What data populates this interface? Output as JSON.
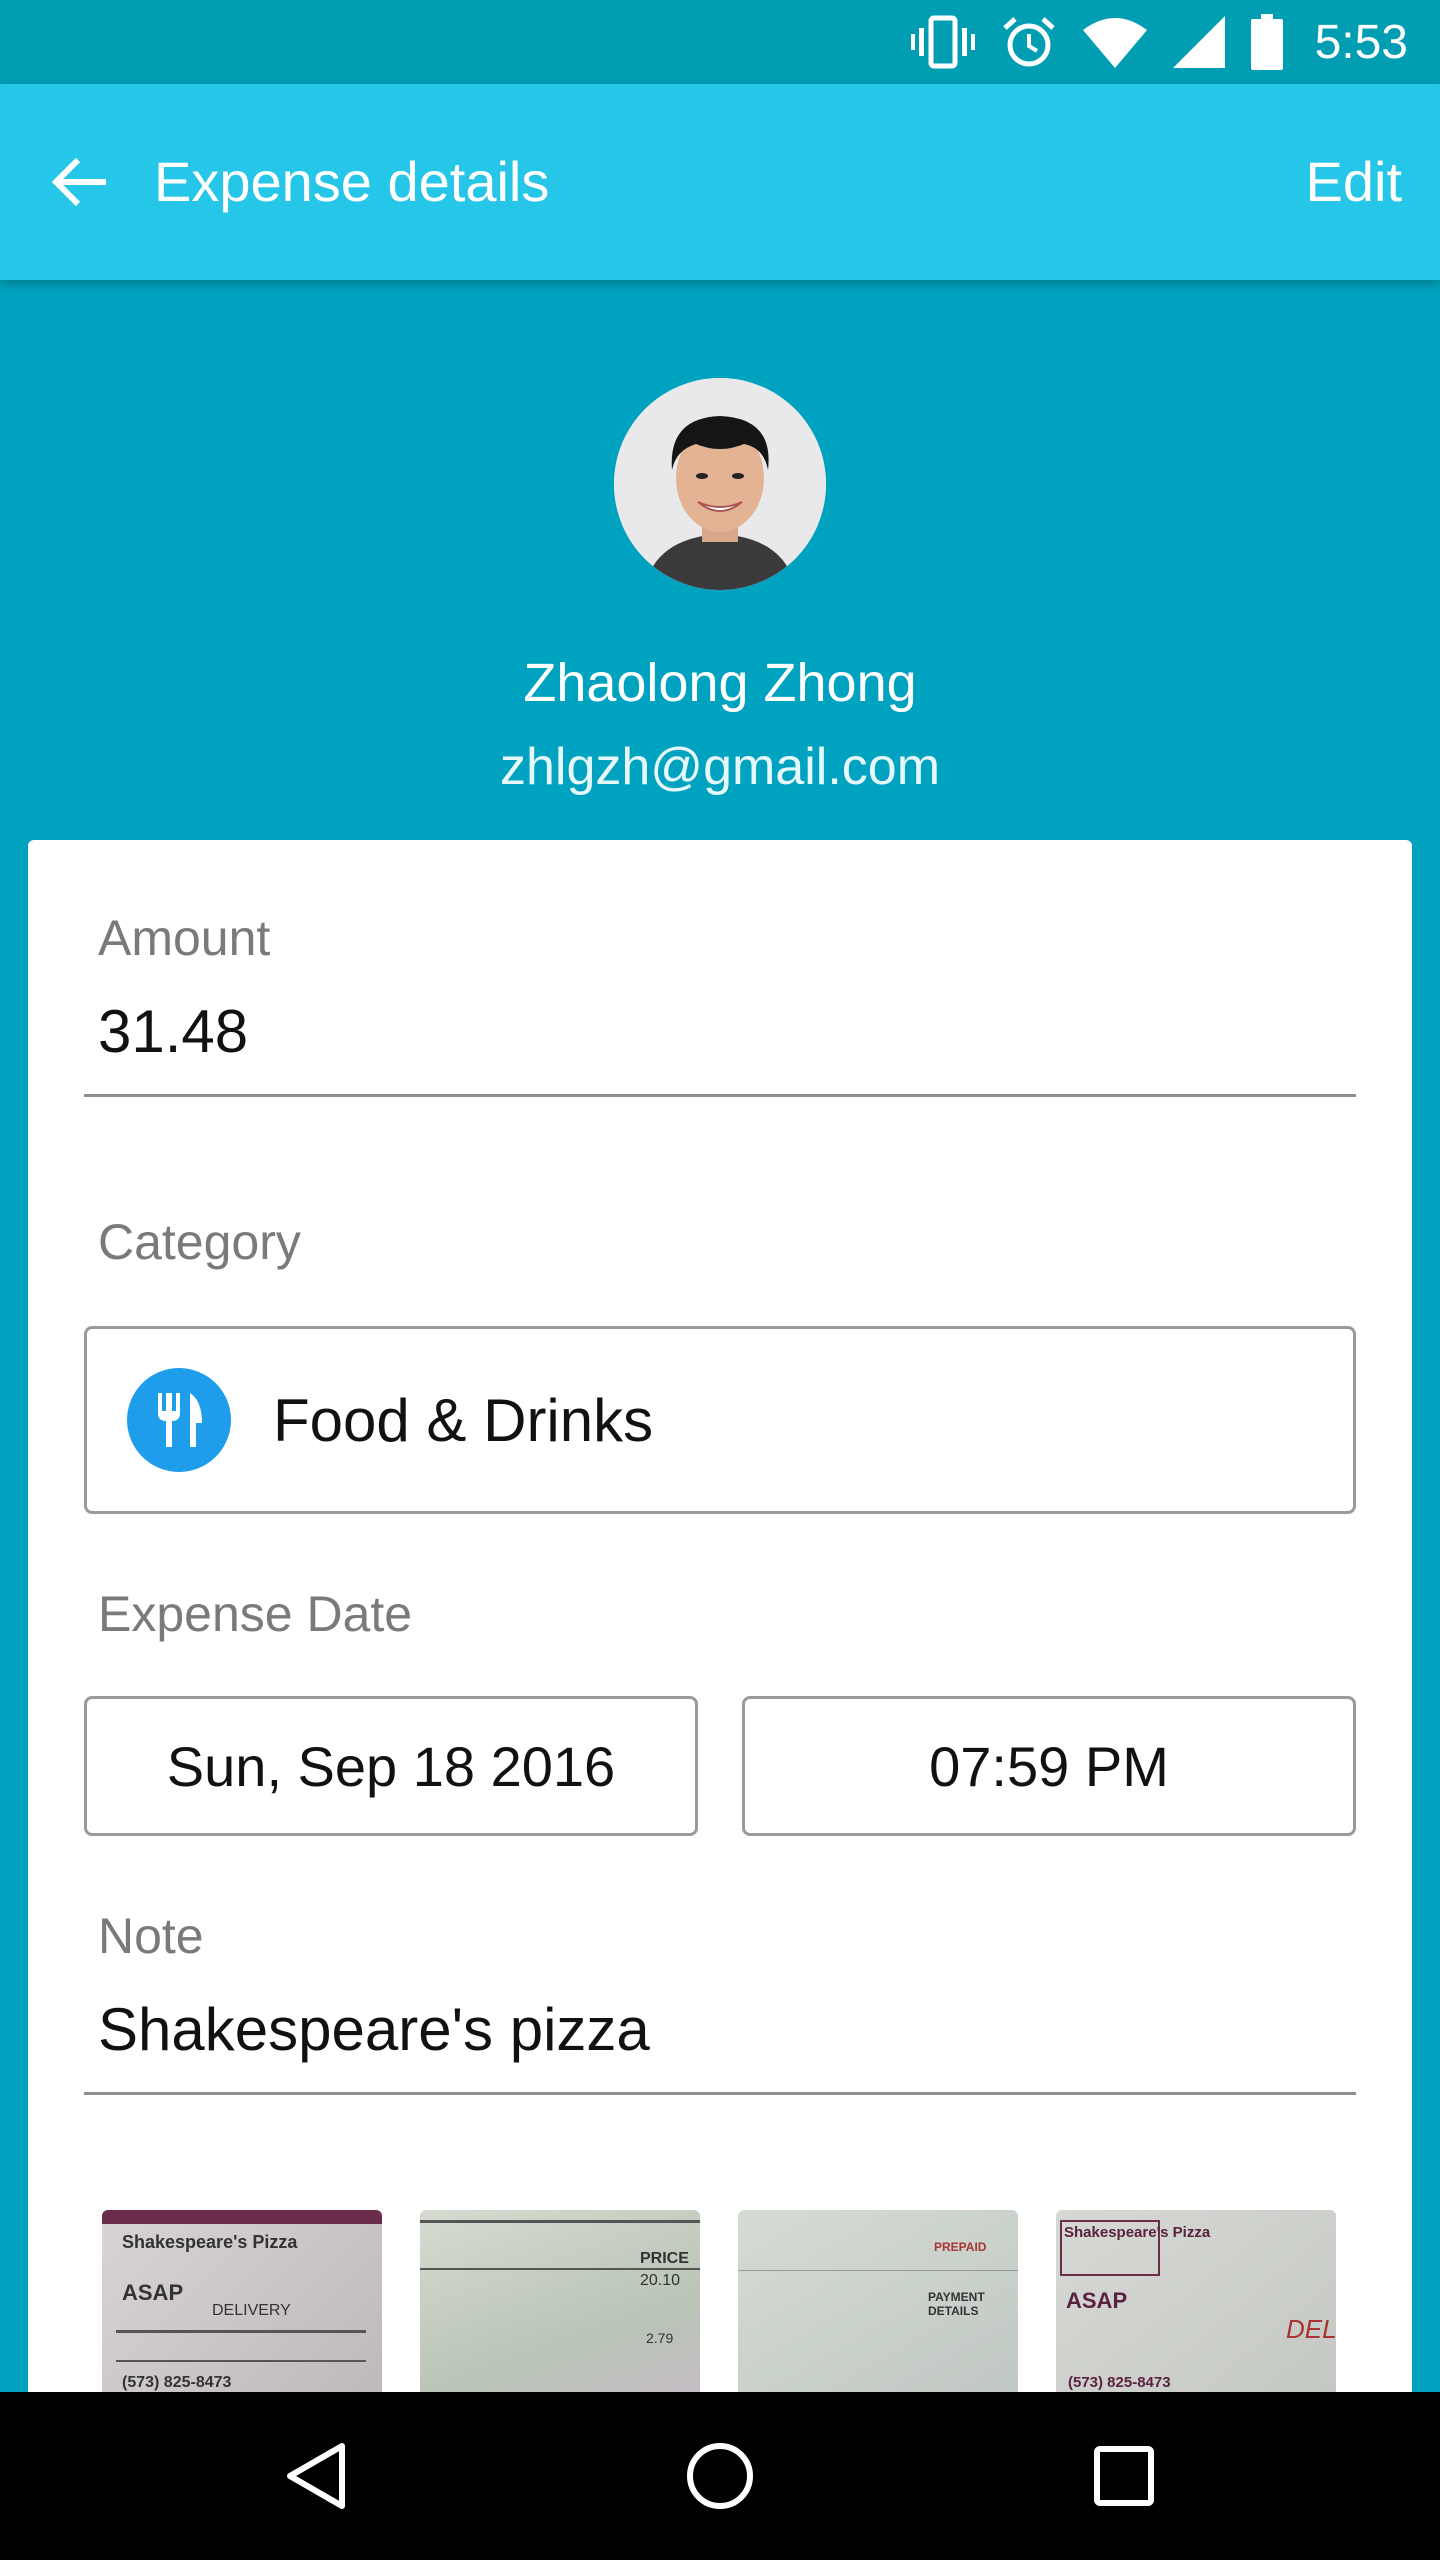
{
  "status_bar": {
    "time": "5:53",
    "icons": [
      "vibrate-icon",
      "alarm-icon",
      "wifi-icon",
      "signal-icon",
      "battery-icon"
    ]
  },
  "app_bar": {
    "title": "Expense details",
    "edit_label": "Edit",
    "back_icon": "arrow-back-icon"
  },
  "profile": {
    "name": "Zhaolong Zhong",
    "email": "zhlgzh@gmail.com"
  },
  "form": {
    "amount_label": "Amount",
    "amount_value": "31.48",
    "category_label": "Category",
    "category_value": "Food & Drinks",
    "category_icon": "fork-knife-icon",
    "date_label": "Expense Date",
    "date_value": "Sun, Sep 18 2016",
    "time_value": "07:59 PM",
    "note_label": "Note",
    "note_value": "Shakespeare's pizza"
  },
  "receipts": [
    {
      "title": "Shakespeare's Pizza",
      "line1": "ASAP",
      "line2": "DELIVERY",
      "phone": "(573) 825-8473"
    },
    {
      "title": "",
      "line1": "PRICE",
      "line2": "20.10",
      "phone": "2.79"
    },
    {
      "title": "",
      "line1": "PREPAID",
      "line2": "PAYMENT DETAILS",
      "phone": ""
    },
    {
      "title": "Shakespeare's Pizza",
      "line1": "ASAP",
      "line2": "DEL",
      "phone": "(573) 825-8473"
    }
  ],
  "colors": {
    "status_bar": "#009DB3",
    "app_bar": "#26C6E8",
    "background": "#00A3BF",
    "category_icon_bg": "#1E9DEB"
  },
  "nav": {
    "icons": [
      "back-triangle-icon",
      "home-circle-icon",
      "recents-square-icon"
    ]
  }
}
